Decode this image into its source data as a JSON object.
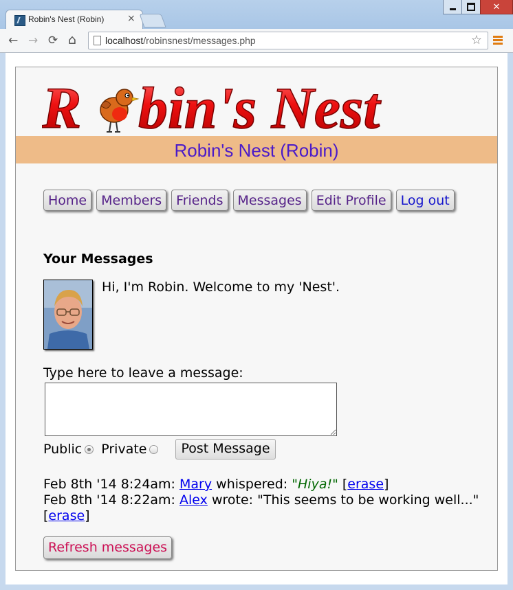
{
  "browser": {
    "tab_title": "Robin's Nest (Robin)",
    "tab_close": "×",
    "url_host": "localhost",
    "url_path": "/robinsnest/messages.php",
    "back_icon": "←",
    "forward_icon": "→",
    "reload_icon": "⟳",
    "home_icon": "⌂",
    "star_icon": "☆",
    "close_glyph": "✕"
  },
  "site": {
    "logo_text_before": "R",
    "logo_text_after": "bin's Nest",
    "banner": "Robin's Nest (Robin)",
    "colors": {
      "banner_bg": "#eebb88",
      "banner_text": "#4a1ac9",
      "logo_red": "#ee1111"
    }
  },
  "menu": {
    "items": [
      "Home",
      "Members",
      "Friends",
      "Messages",
      "Edit Profile",
      "Log out"
    ]
  },
  "main": {
    "section_title": "Your Messages",
    "bio": "Hi, I'm Robin. Welcome to my 'Nest'.",
    "message_label": "Type here to leave a message:",
    "public_label": "Public",
    "private_label": "Private",
    "post_button": "Post Message",
    "refresh_button": "Refresh messages"
  },
  "messages": [
    {
      "date": "Feb 8th '14 8:24am:",
      "user": "Mary",
      "verb": "whispered:",
      "text": "\"Hiya!\"",
      "erase": "erase"
    },
    {
      "date": "Feb 8th '14 8:22am:",
      "user": "Alex",
      "verb": "wrote:",
      "text": "\"This seems to be working well...\"",
      "erase": "erase"
    }
  ]
}
